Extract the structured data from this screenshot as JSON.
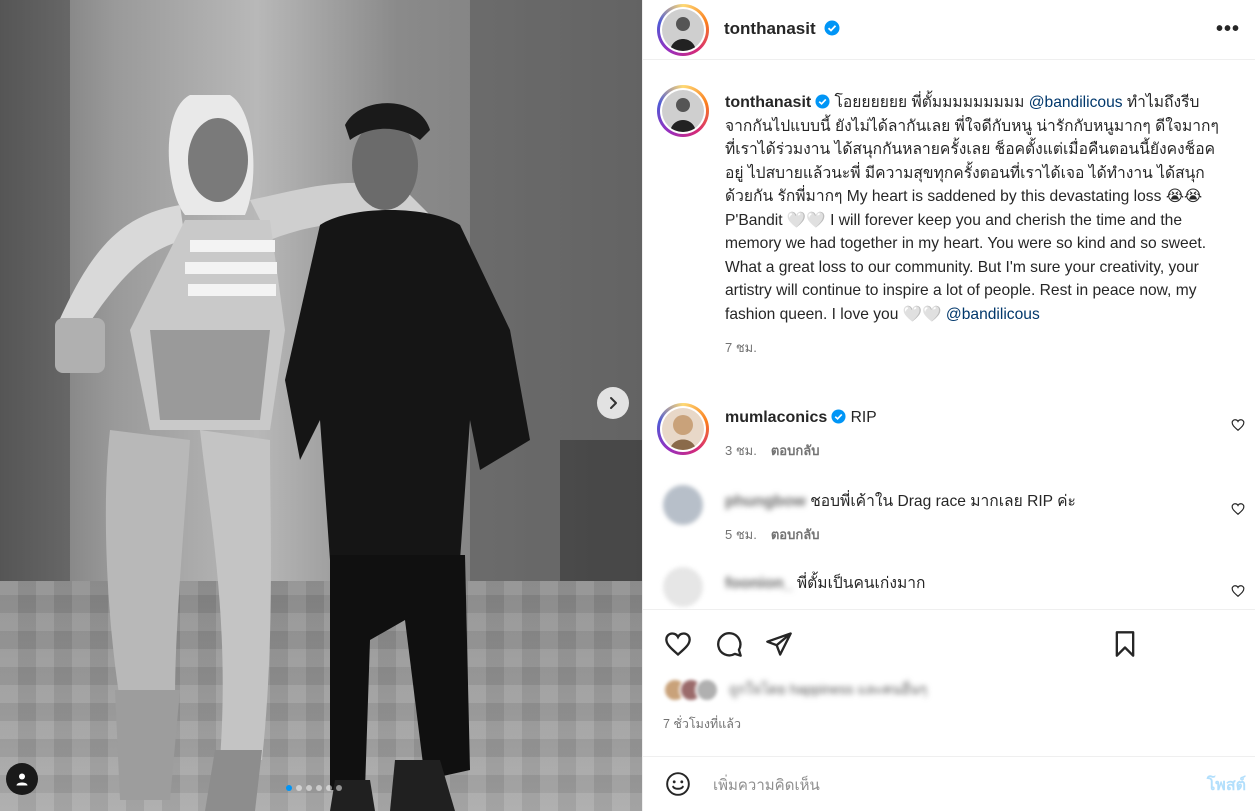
{
  "photo": {
    "next_icon": "chevron-right-icon",
    "user_tag_icon": "user-icon",
    "dots_total": 6,
    "dots_active": 0
  },
  "header": {
    "username": "tonthanasit",
    "verified": true,
    "more_icon": "more-horizontal-icon",
    "more_label": "•••"
  },
  "caption": {
    "username": "tonthanasit",
    "parts": [
      {
        "type": "text",
        "value": " โอยยยยยย พี่ตั้มมมมมมมมม "
      },
      {
        "type": "mention",
        "value": "@bandilicous"
      },
      {
        "type": "text",
        "value": " ทำไมถึงรีบจากกันไปแบบนี้ ยังไม่ได้ลากันเลย พี่ใจดีกับหนู น่ารักกับหนูมากๆ ดีใจมากๆที่เราได้ร่วมงาน ได้สนุกกันหลายครั้งเลย ช็อคตั้งแต่เมื่อคืนตอนนี้ยังคงช็อคอยู่ ไปสบายแล้วนะพี่ มีความสุขทุกครั้งตอนที่เราได้เจอ ได้ทำงาน ได้สนุกด้วยกัน รักพี่มากๆ My heart is saddened by this devastating loss 😭😭 P'Bandit 🤍🤍 I will forever keep you and cherish the time and the memory we had together in my heart. You were so kind and so sweet. What a great loss to our community. But I'm sure your creativity, your artistry will continue to inspire a lot of people. Rest in peace now, my fashion queen. I love you 🤍🤍 "
      },
      {
        "type": "mention",
        "value": "@bandilicous"
      }
    ],
    "time": "7 ชม."
  },
  "comments": [
    {
      "username": "mumlaconics",
      "verified": true,
      "text": "RIP",
      "time": "3 ชม.",
      "reply": "ตอบกลับ",
      "blurred": false
    },
    {
      "username": "phungbow",
      "verified": false,
      "text": "ชอบพี่เค้าใน Drag race มากเลย RIP ค่ะ",
      "time": "5 ชม.",
      "reply": "ตอบกลับ",
      "blurred": true
    },
    {
      "username": "foonion_",
      "verified": false,
      "text": "พี่ตั้มเป็นคนเก่งมาก",
      "time": "",
      "reply": "",
      "blurred": true
    }
  ],
  "actions": {
    "like_icon": "heart-icon",
    "comment_icon": "comment-icon",
    "share_icon": "share-icon",
    "save_icon": "bookmark-icon"
  },
  "likes_text": "ถูกใจโดย happiness และคนอื่นๆ",
  "time_ago": "7 ชั่วโมงที่แล้ว",
  "comment_box": {
    "emoji_icon": "emoji-icon",
    "placeholder": "เพิ่มความคิดเห็น",
    "post_label": "โพสต์"
  },
  "colors": {
    "verified": "#0095f6",
    "mention": "#00376b",
    "post_disabled": "#b2dffc"
  }
}
